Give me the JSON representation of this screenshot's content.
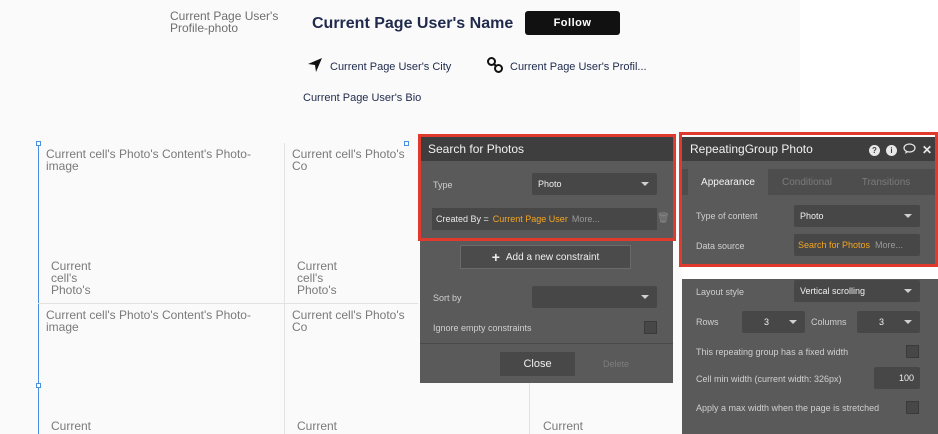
{
  "header": {
    "profile_photo": "Current Page User's Profile-photo",
    "user_name": "Current Page User's Name",
    "follow_label": "Follow",
    "city": "Current Page User's City",
    "profile_link": "Current Page User's Profil...",
    "bio": "Current Page User's Bio"
  },
  "repeating_group": {
    "cell_image": "Current cell's Photo's Content's Photo-image",
    "cell_image_truncated": "Current cell's Photo's Co",
    "cell_caption": "Current cell's Photo's",
    "cell_caption_cut": "Current"
  },
  "search_panel": {
    "title": "Search for Photos",
    "type_label": "Type",
    "type_value": "Photo",
    "constraint_field": "Created By =",
    "constraint_value": "Current Page User",
    "constraint_more": "More...",
    "add_constraint": "Add a new constraint",
    "sort_by_label": "Sort by",
    "sort_by_value": "",
    "ignore_empty_label": "Ignore empty constraints",
    "close_label": "Close",
    "delete_label": "Delete"
  },
  "property_editor": {
    "title": "RepeatingGroup Photo",
    "tabs": [
      "Appearance",
      "Conditional",
      "Transitions"
    ],
    "type_of_content_label": "Type of content",
    "type_of_content_value": "Photo",
    "data_source_label": "Data source",
    "data_source_value": "Search for Photos",
    "data_source_more": "More...",
    "layout_style_label": "Layout style",
    "layout_style_value": "Vertical scrolling",
    "rows_label": "Rows",
    "rows_value": "3",
    "columns_label": "Columns",
    "columns_value": "3",
    "fixed_width_label": "This repeating group has a fixed width",
    "cell_min_width_label": "Cell min width (current width: 326px)",
    "cell_min_width_value": "100",
    "max_width_label": "Apply a max width when the page is stretched"
  },
  "colors": {
    "highlight": "#e03a2f",
    "panel_bg": "#5a5a5a",
    "panel_header": "#3e3e3e",
    "accent_orange": "#f5a623",
    "title_text": "#1f2a4c"
  }
}
